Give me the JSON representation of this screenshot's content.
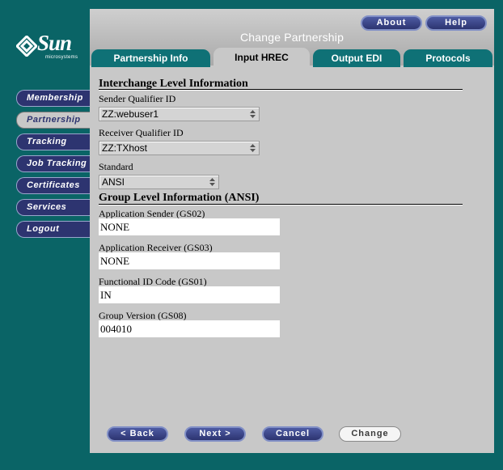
{
  "brand": {
    "name": "Sun",
    "tagline": "microsystems"
  },
  "sidebar": {
    "items": [
      {
        "label": "Membership"
      },
      {
        "label": "Partnership"
      },
      {
        "label": "Tracking"
      },
      {
        "label": "Job Tracking"
      },
      {
        "label": "Certificates"
      },
      {
        "label": "Services"
      },
      {
        "label": "Logout"
      }
    ],
    "active": "Partnership"
  },
  "header": {
    "title": "Change Partnership",
    "about_label": "About",
    "help_label": "Help"
  },
  "tabs": [
    {
      "label": "Partnership Info"
    },
    {
      "label": "Input HREC"
    },
    {
      "label": "Output EDI"
    },
    {
      "label": "Protocols"
    }
  ],
  "active_tab": "Input HREC",
  "interchange": {
    "title": "Interchange Level Information",
    "sender_label": "Sender Qualifier ID",
    "sender_value": "ZZ:webuser1",
    "receiver_label": "Receiver Qualifier ID",
    "receiver_value": "ZZ:TXhost",
    "standard_label": "Standard",
    "standard_value": "ANSI"
  },
  "group": {
    "title": "Group Level Information (ANSI)",
    "app_sender_label": "Application Sender (GS02)",
    "app_sender_value": "NONE",
    "app_receiver_label": "Application Receiver (GS03)",
    "app_receiver_value": "NONE",
    "func_id_label": "Functional ID Code (GS01)",
    "func_id_value": "IN",
    "version_label": "Group Version (GS08)",
    "version_value": "004010"
  },
  "buttons": {
    "back": "< Back",
    "next": "Next >",
    "cancel": "Cancel",
    "change": "Change"
  },
  "colors": {
    "background": "#0a6466",
    "panel": "#c8c8c8",
    "nav_button": "#2d3470",
    "tab": "#0f7176"
  }
}
